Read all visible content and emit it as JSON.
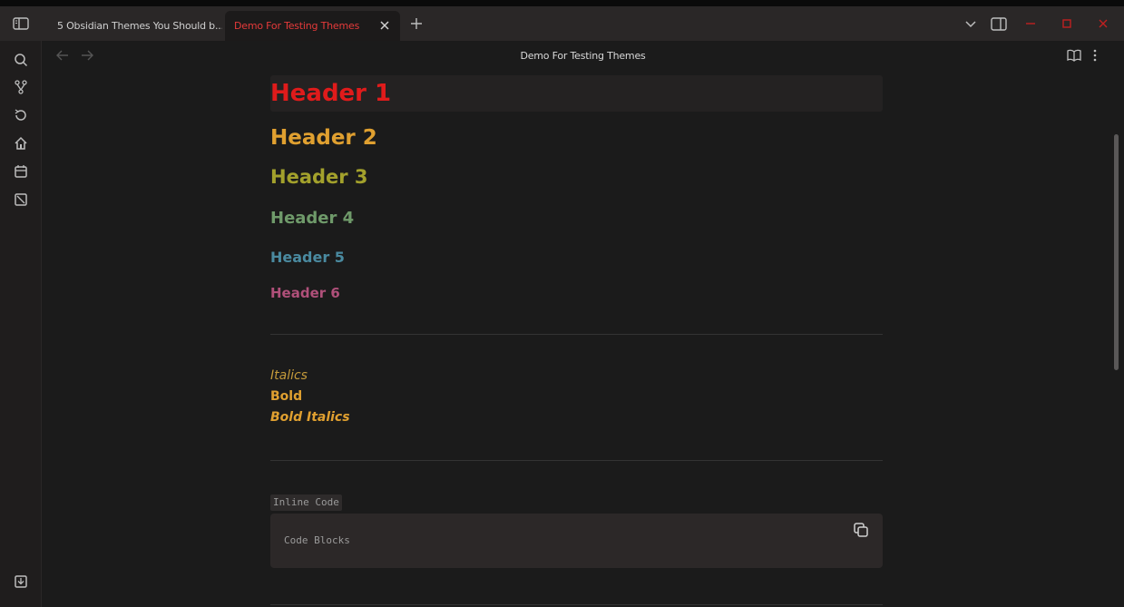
{
  "tabs": [
    {
      "label": "5 Obsidian Themes You Should b...",
      "active": false
    },
    {
      "label": "Demo For Testing Themes",
      "active": true
    }
  ],
  "view": {
    "title": "Demo For Testing Themes"
  },
  "ribbon": {
    "icons": [
      "search-icon",
      "graph-icon",
      "sync-icon",
      "home-icon",
      "calendar-icon",
      "canvas-icon",
      "import-icon"
    ]
  },
  "document": {
    "headers": [
      "Header 1",
      "Header 2",
      "Header 3",
      "Header 4",
      "Header 5",
      "Header 6"
    ],
    "italics": "Italics",
    "bold": "Bold",
    "bold_italics": "Bold Italics",
    "inline_code": "Inline Code",
    "code_block": "Code Blocks"
  },
  "colors": {
    "h1": "#e01b1b",
    "h2": "#e0a030",
    "h3": "#a3a12c",
    "h4": "#6f9a6a",
    "h5": "#4a8aa0",
    "h6": "#b0507a",
    "active_tab_text": "#e53a3a"
  }
}
